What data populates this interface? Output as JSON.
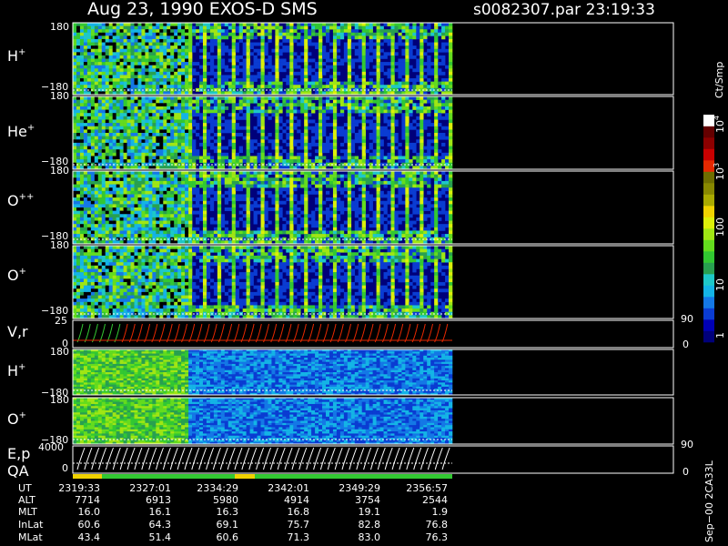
{
  "header": {
    "title": "Aug 23, 1990   EXOS-D SMS",
    "file_time": "s0082307.par  23:19:33"
  },
  "colorbar": {
    "unit": "Ct/Smp",
    "ticks": [
      "1",
      "10",
      "100",
      "10",
      "10"
    ],
    "exponents": [
      "",
      "",
      "",
      "3",
      "4"
    ],
    "colors": [
      "#00007a",
      "#0000b4",
      "#0a3cd2",
      "#1478e6",
      "#14b4e6",
      "#1ec8c8",
      "#28a050",
      "#32c832",
      "#64dc1e",
      "#a0e614",
      "#dcf00a",
      "#f0d200",
      "#aaaa00",
      "#888800",
      "#6e6e00",
      "#e62800",
      "#c80000",
      "#8c0000",
      "#640000",
      "#ffffff"
    ]
  },
  "panels": {
    "h_plus": {
      "label": "H",
      "sup": "+",
      "top": "180",
      "bottom": "−180"
    },
    "he_plus": {
      "label": "He",
      "sup": "+",
      "top": "180",
      "bottom": "−180"
    },
    "o_plusplus": {
      "label": "O",
      "sup": "++",
      "top": "180",
      "bottom": "−180"
    },
    "o_plus": {
      "label": "O",
      "sup": "+",
      "top": "180",
      "bottom": "−180"
    },
    "v_r": {
      "label": "V,r",
      "top": "25",
      "bottom": "0",
      "right_top": "90",
      "right_bottom": "0"
    },
    "h_plus_2": {
      "label": "H",
      "sup": "+",
      "top": "180",
      "bottom": "−180"
    },
    "o_plus_2": {
      "label": "O",
      "sup": "+",
      "top": "180",
      "bottom": "−180"
    },
    "e_p": {
      "label": "E,p",
      "top": "4000",
      "bottom": "0",
      "right_top": "90",
      "right_bottom": "0"
    },
    "qa": {
      "label": "QA"
    }
  },
  "chart_data": {
    "type": "heatmap",
    "x_axis_unit": "UT",
    "ephemeris": {
      "rows": [
        "UT",
        "ALT",
        "MLT",
        "InLat",
        "MLat"
      ],
      "columns": [
        {
          "UT": "2319:33",
          "ALT": "7714",
          "MLT": "16.0",
          "InLat": "60.6",
          "MLat": "43.4"
        },
        {
          "UT": "2327:01",
          "ALT": "6913",
          "MLT": "16.1",
          "InLat": "64.3",
          "MLat": "51.4"
        },
        {
          "UT": "2334:29",
          "ALT": "5980",
          "MLT": "16.3",
          "InLat": "69.1",
          "MLat": "60.6"
        },
        {
          "UT": "2342:01",
          "ALT": "4914",
          "MLT": "16.8",
          "InLat": "75.7",
          "MLat": "71.3"
        },
        {
          "UT": "2349:29",
          "ALT": "3754",
          "MLT": "19.1",
          "InLat": "82.8",
          "MLat": "83.0"
        },
        {
          "UT": "2356:57",
          "ALT": "2544",
          "MLT": "1.9",
          "InLat": "76.8",
          "MLat": "76.3"
        }
      ]
    },
    "spectrogram_panels": [
      {
        "species": "H+",
        "ylim": [
          -180,
          180
        ]
      },
      {
        "species": "He+",
        "ylim": [
          -180,
          180
        ]
      },
      {
        "species": "O++",
        "ylim": [
          -180,
          180
        ]
      },
      {
        "species": "O+",
        "ylim": [
          -180,
          180
        ]
      },
      {
        "species": "H+",
        "ylim": [
          -180,
          180
        ]
      },
      {
        "species": "O+",
        "ylim": [
          -180,
          180
        ]
      }
    ],
    "line_panels": [
      {
        "label": "V,r",
        "ylim": [
          0,
          25
        ],
        "right_ylim": [
          0,
          90
        ]
      },
      {
        "label": "E,p",
        "ylim": [
          0,
          4000
        ],
        "right_ylim": [
          0,
          90
        ]
      }
    ],
    "colorbar_range": [
      1,
      10000
    ],
    "colorbar_scale": "log"
  },
  "footer": {
    "vertical_note": "Sep−00  2CA33L"
  }
}
